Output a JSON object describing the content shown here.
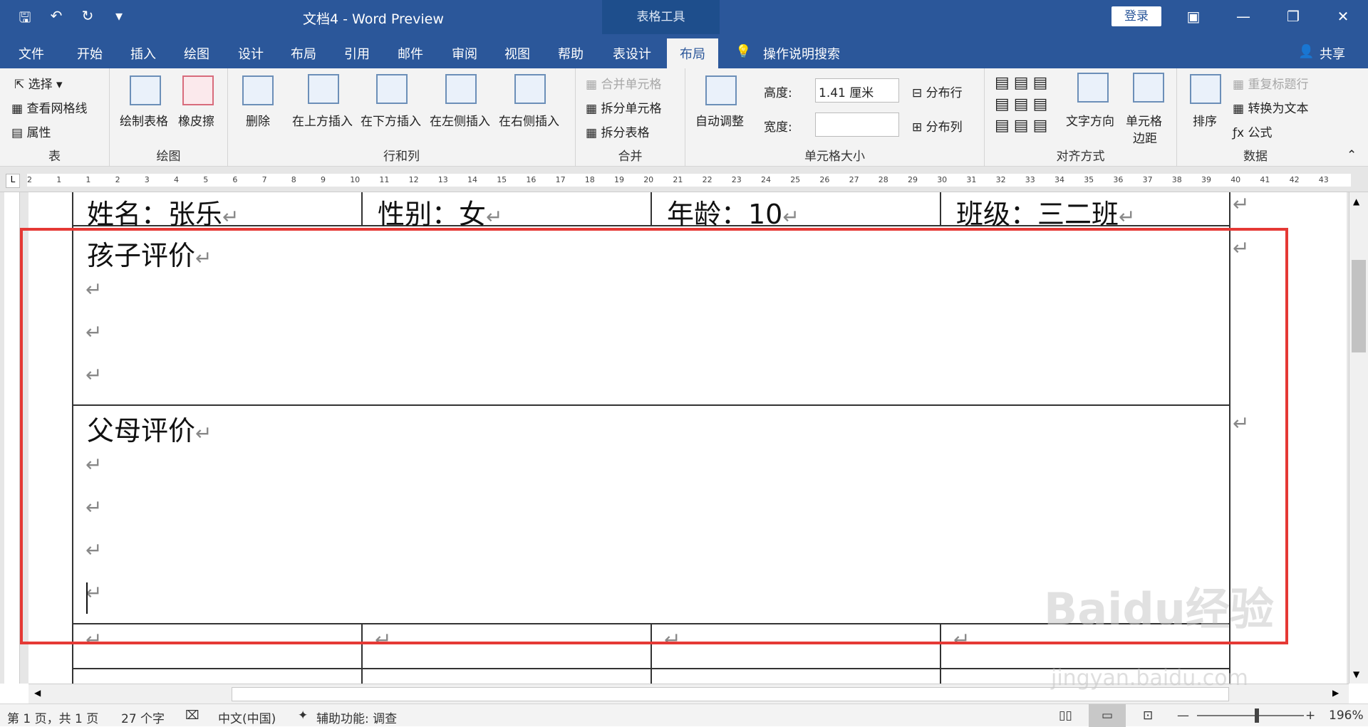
{
  "titlebar": {
    "title": "文档4  -  Word Preview",
    "context_group": "表格工具",
    "login": "登录",
    "qat_icons": [
      "save-icon",
      "undo-icon",
      "redo-icon",
      "customize-icon"
    ]
  },
  "tabs": [
    "文件",
    "开始",
    "插入",
    "绘图",
    "设计",
    "布局",
    "引用",
    "邮件",
    "审阅",
    "视图",
    "帮助",
    "表设计",
    "布局"
  ],
  "tell_me": "操作说明搜索",
  "share": "共享",
  "ribbon": {
    "table": {
      "select": "选择",
      "gridlines": "查看网格线",
      "props": "属性",
      "label": "表"
    },
    "draw": {
      "draw_table": "绘制表格",
      "eraser": "橡皮擦",
      "label": "绘图"
    },
    "rows": {
      "delete": "删除",
      "above": "在上方插入",
      "below": "在下方插入",
      "left": "在左侧插入",
      "right": "在右侧插入",
      "label": "行和列"
    },
    "merge": {
      "merge_cells": "合并单元格",
      "split_cells": "拆分单元格",
      "split_table": "拆分表格",
      "label": "合并"
    },
    "cellsize": {
      "autofit": "自动调整",
      "height_label": "高度:",
      "height_value": "1.41 厘米",
      "width_label": "宽度:",
      "width_value": "",
      "dist_rows": "分布行",
      "dist_cols": "分布列",
      "label": "单元格大小"
    },
    "align": {
      "text_dir": "文字方向",
      "margins": "单元格",
      "margins2": "边距",
      "label": "对齐方式"
    },
    "data": {
      "sort": "排序",
      "repeat_header": "重复标题行",
      "convert": "转换为文本",
      "formula": "公式",
      "label": "数据"
    }
  },
  "ruler_numbers": [
    "2",
    "1",
    "1",
    "2",
    "3",
    "4",
    "5",
    "6",
    "7",
    "8",
    "9",
    "10",
    "11",
    "12",
    "13",
    "14",
    "15",
    "16",
    "17",
    "18",
    "19",
    "20",
    "21",
    "22",
    "23",
    "24",
    "25",
    "26",
    "27",
    "28",
    "29",
    "30",
    "31",
    "32",
    "33",
    "34",
    "35",
    "36",
    "37",
    "38",
    "39",
    "40",
    "41",
    "42",
    "43"
  ],
  "document": {
    "row1": [
      "姓名：张乐",
      "性别：女",
      "年龄：10",
      "班级：三二班"
    ],
    "child_eval": "孩子评价",
    "parent_eval": "父母评价",
    "return_mark": "↵"
  },
  "status": {
    "page": "第 1 页，共 1 页",
    "words": "27 个字",
    "lang": "中文(中国)",
    "access": "辅助功能: 调查",
    "zoom": "196%"
  },
  "watermark": {
    "brand": "Baidu经验",
    "url": "jingyan.baidu.com"
  }
}
